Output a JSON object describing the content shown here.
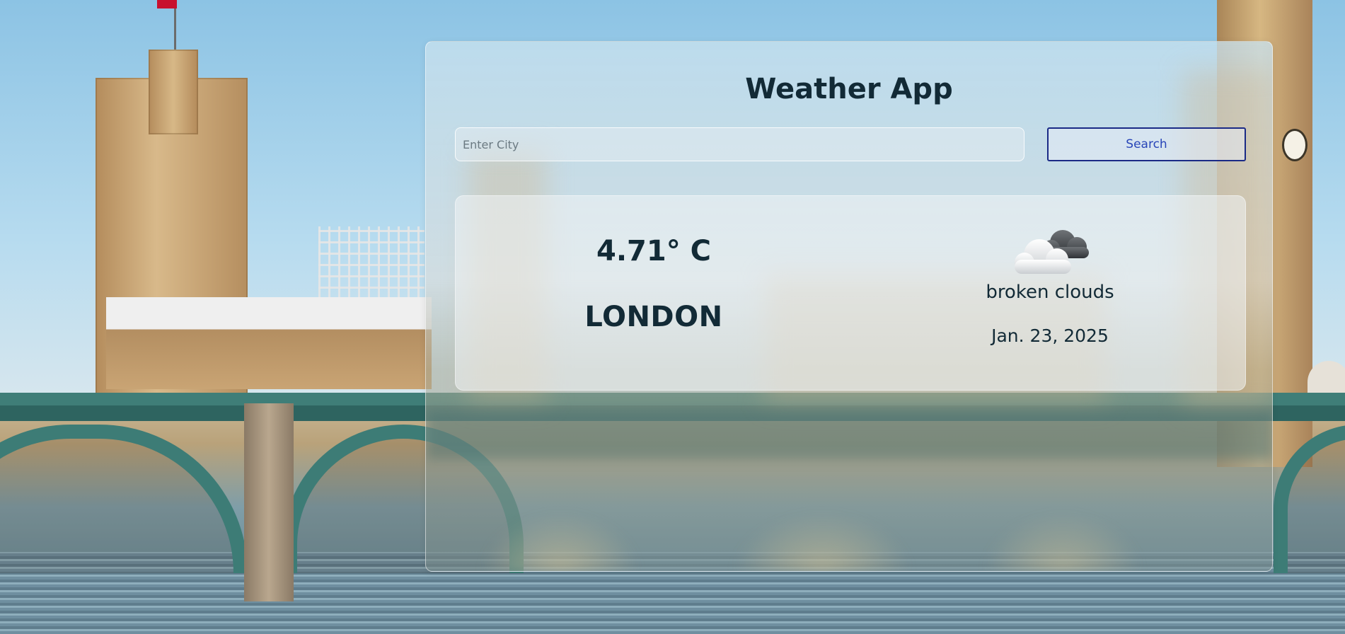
{
  "app": {
    "title": "Weather App"
  },
  "search": {
    "placeholder": "Enter City",
    "value": "",
    "button_label": "Search"
  },
  "weather": {
    "temperature": "4.71° C",
    "city": "LONDON",
    "icon": "broken-clouds-icon",
    "description": "broken clouds",
    "date": "Jan. 23, 2025"
  },
  "colors": {
    "title_text": "#122a36",
    "button_border": "#1a2a86",
    "button_text": "#2845b8"
  }
}
